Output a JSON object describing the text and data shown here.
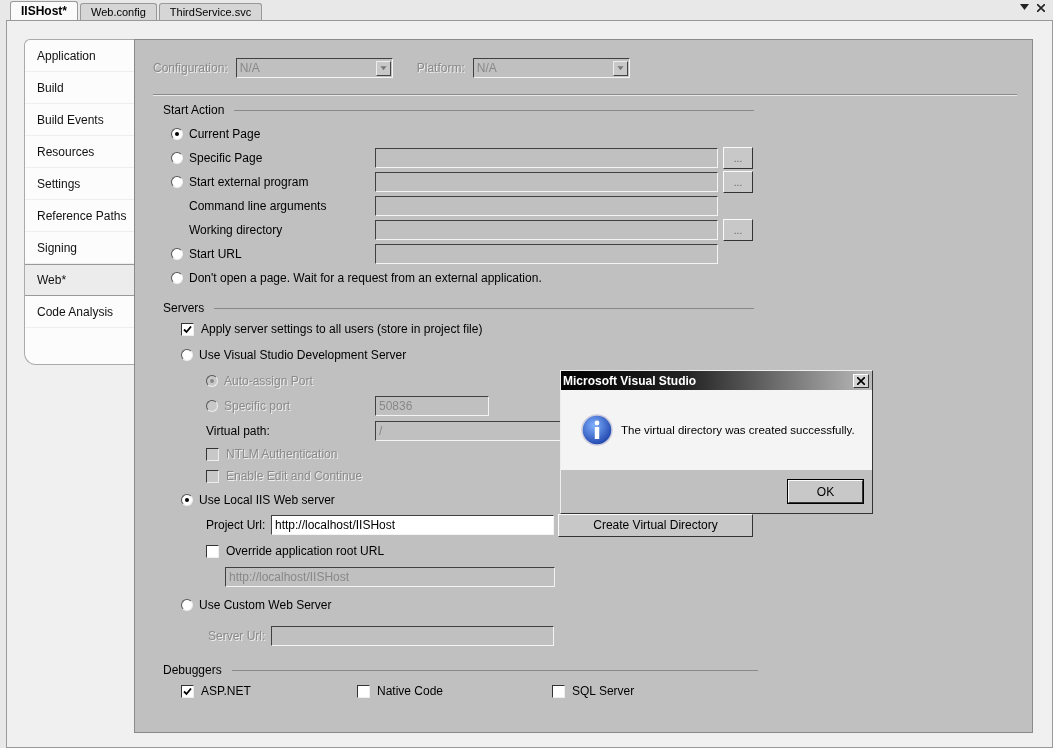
{
  "tabs": [
    {
      "label": "IISHost*",
      "selected": true
    },
    {
      "label": "Web.config",
      "selected": false
    },
    {
      "label": "ThirdService.svc",
      "selected": false
    }
  ],
  "sidebar": {
    "items": [
      {
        "label": "Application",
        "selected": false
      },
      {
        "label": "Build",
        "selected": false
      },
      {
        "label": "Build Events",
        "selected": false
      },
      {
        "label": "Resources",
        "selected": false
      },
      {
        "label": "Settings",
        "selected": false
      },
      {
        "label": "Reference Paths",
        "selected": false
      },
      {
        "label": "Signing",
        "selected": false
      },
      {
        "label": "Web*",
        "selected": true
      },
      {
        "label": "Code Analysis",
        "selected": false
      }
    ]
  },
  "config": {
    "configuration": {
      "label": "Configuration:",
      "value": "N/A",
      "disabled": true
    },
    "platform": {
      "label": "Platform:",
      "value": "N/A",
      "disabled": true
    }
  },
  "start_action": {
    "title": "Start Action",
    "options": [
      {
        "kind": "radio",
        "label": "Current Page",
        "selected": true
      },
      {
        "kind": "radio-field",
        "label": "Specific Page",
        "selected": false,
        "browse": "..."
      },
      {
        "kind": "radio-field",
        "label": "Start external program",
        "selected": false,
        "browse": "..."
      },
      {
        "kind": "label-field",
        "label": "Command line arguments"
      },
      {
        "kind": "label-field",
        "label": "Working directory",
        "browse": "..."
      },
      {
        "kind": "radio-field",
        "label": "Start URL",
        "selected": false
      },
      {
        "kind": "radio",
        "label": "Don't open a page.  Wait for a request from an external application.",
        "selected": false
      }
    ]
  },
  "servers": {
    "title": "Servers",
    "apply_all": {
      "label": "Apply server settings to all users (store in project file)",
      "checked": true
    },
    "dev_server": {
      "label": "Use Visual Studio Development Server",
      "selected": false,
      "auto_port": {
        "label": "Auto-assign Port",
        "selected": true,
        "disabled": true
      },
      "specific_port": {
        "label": "Specific port",
        "selected": false,
        "disabled": true,
        "value": "50836"
      },
      "virtual_path": {
        "label": "Virtual path:",
        "value": "/"
      },
      "ntlm": {
        "label": "NTLM Authentication",
        "checked": false,
        "disabled": true
      },
      "edit_continue": {
        "label": "Enable Edit and Continue",
        "checked": false,
        "disabled": true
      }
    },
    "local_iis": {
      "label": "Use Local IIS Web server",
      "selected": true,
      "project_url": {
        "label": "Project Url:",
        "value": "http://localhost/IISHost"
      },
      "create_button": "Create Virtual Directory",
      "override": {
        "label": "Override application root URL",
        "checked": false
      },
      "root_url": {
        "value": "http://localhost/IISHost",
        "disabled": true
      }
    },
    "custom": {
      "label": "Use Custom Web Server",
      "selected": false,
      "server_url": {
        "label": "Server Url:",
        "disabled": true
      }
    }
  },
  "debuggers": {
    "title": "Debuggers",
    "items": [
      {
        "label": "ASP.NET",
        "checked": true
      },
      {
        "label": "Native Code",
        "checked": false
      },
      {
        "label": "SQL Server",
        "checked": false
      }
    ]
  },
  "dialog": {
    "title": "Microsoft Visual Studio",
    "message": "The virtual directory was created successfully.",
    "ok": "OK"
  }
}
